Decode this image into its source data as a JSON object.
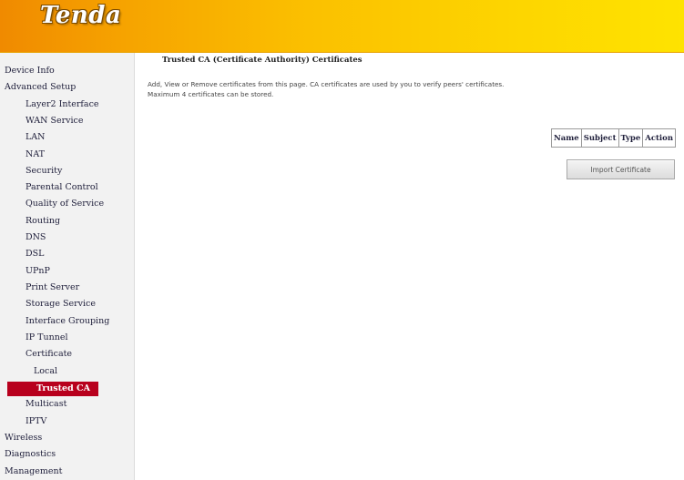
{
  "brand": {
    "logo_text": "Tenda"
  },
  "sidebar": {
    "items": [
      {
        "label": "Device Info"
      },
      {
        "label": "Advanced Setup"
      },
      {
        "label": "Layer2 Interface"
      },
      {
        "label": "WAN Service"
      },
      {
        "label": "LAN"
      },
      {
        "label": "NAT"
      },
      {
        "label": "Security"
      },
      {
        "label": "Parental Control"
      },
      {
        "label": "Quality of Service"
      },
      {
        "label": "Routing"
      },
      {
        "label": "DNS"
      },
      {
        "label": "DSL"
      },
      {
        "label": "UPnP"
      },
      {
        "label": "Print Server"
      },
      {
        "label": "Storage Service"
      },
      {
        "label": "Interface Grouping"
      },
      {
        "label": "IP Tunnel"
      },
      {
        "label": "Certificate"
      },
      {
        "label": "Local"
      },
      {
        "label": "Trusted CA",
        "active": true
      },
      {
        "label": "Multicast"
      },
      {
        "label": "IPTV"
      },
      {
        "label": "Wireless"
      },
      {
        "label": "Diagnostics"
      },
      {
        "label": "Management"
      }
    ]
  },
  "main": {
    "title": "Trusted CA (Certificate Authority) Certificates",
    "description_line1": "Add, View or Remove certificates from this page. CA certificates are used by you to verify peers' certificates.",
    "description_line2": "Maximum 4 certificates can be stored.",
    "table": {
      "headers": [
        "Name",
        "Subject",
        "Type",
        "Action"
      ]
    },
    "import_button": "Import Certificate"
  },
  "colors": {
    "header_gradient_start": "#f08a00",
    "header_gradient_end": "#fee300",
    "active_nav_bg": "#b8001d"
  }
}
